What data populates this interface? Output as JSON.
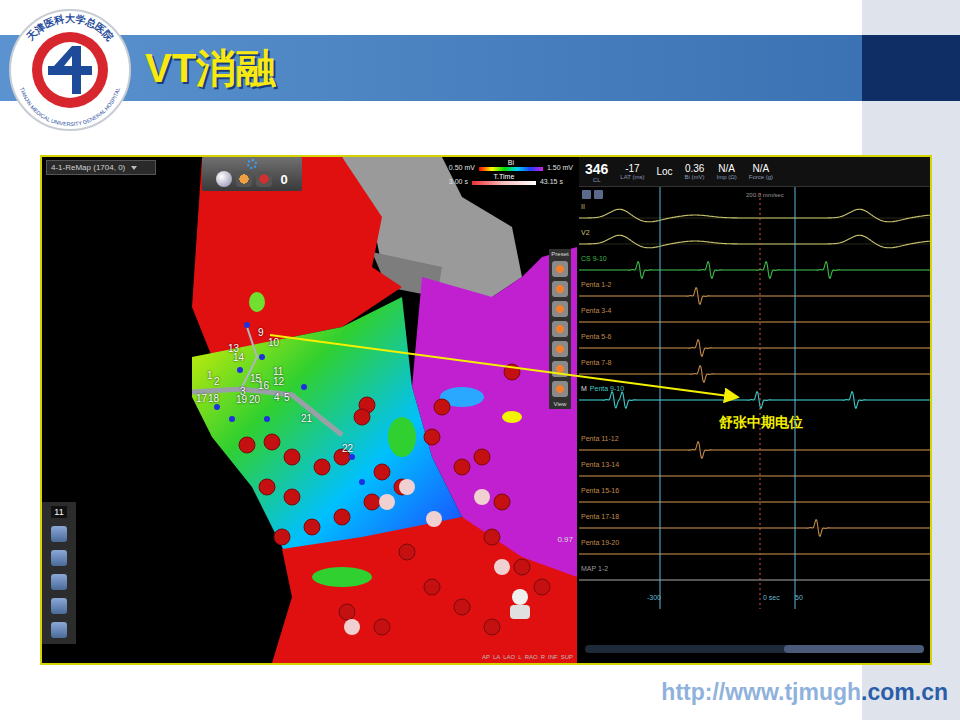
{
  "slide": {
    "title": "VT消融",
    "url_parts": [
      "http://www.tjmugh",
      ".com.cn"
    ]
  },
  "logo": {
    "ring_top": "天津医科大学总医院",
    "ring_bottom": "TIANJIN MEDICAL UNIVERSITY GENERAL HOSPITAL"
  },
  "map": {
    "dropdown": "4-1-ReMap (1704, 0)",
    "toolbar_count": "0",
    "legends": [
      {
        "min": "0.50 mV",
        "name": "Bi",
        "max": "1.50 mV",
        "kind": "rainbow"
      },
      {
        "min": "3.00 s",
        "name": "T.Time",
        "max": "43.15 s",
        "kind": "time"
      }
    ],
    "side_tools": [
      "Preset",
      "View"
    ],
    "left_tool_count": "11",
    "value": "0.97",
    "orientation": [
      "AP",
      "LA",
      "LAO",
      "L",
      "RAO",
      "R",
      "INF",
      "SUP"
    ],
    "electrodes": [
      "9",
      "10",
      "13",
      "14",
      "11",
      "12",
      "15",
      "16",
      "1",
      "2",
      "17",
      "18",
      "3",
      "19",
      "20",
      "4",
      "5",
      "21",
      "22"
    ]
  },
  "traces": {
    "readouts": [
      {
        "value": "346",
        "label": "CL"
      },
      {
        "value": "-17",
        "label": "LAT (ms)"
      },
      {
        "value": "Loc",
        "label": ""
      },
      {
        "value": "0.36",
        "label": "Bi (mV)"
      },
      {
        "value": "N/A",
        "label": "Imp (Ω)"
      },
      {
        "value": "N/A",
        "label": "Force (g)"
      }
    ],
    "speed": "200.0 mm/sec",
    "marker": "M",
    "axis": [
      "-300",
      "0 sec",
      "50"
    ],
    "annotation": {
      "text": "舒张中期电位",
      "channel": "Penta 9-10"
    },
    "channels": [
      {
        "name": "II",
        "color": "#c9c46f",
        "kind": "surface",
        "selected": false,
        "events_ms": [
          -420,
          300
        ]
      },
      {
        "name": "V2",
        "color": "#c9c46f",
        "kind": "surface",
        "selected": false,
        "events_ms": [
          -420,
          300
        ]
      },
      {
        "name": "CS 9-10",
        "color": "#3cb94a",
        "kind": "bipolar",
        "selected": false,
        "events_ms": [
          -360,
          -150,
          24,
          204
        ]
      },
      {
        "name": "Penta 1-2",
        "color": "#c08a4a",
        "kind": "bipolar",
        "selected": false,
        "events_ms": [
          -186
        ]
      },
      {
        "name": "Penta 3-4",
        "color": "#c08a4a",
        "kind": "bipolar",
        "selected": false,
        "events_ms": []
      },
      {
        "name": "Penta 5-6",
        "color": "#c08a4a",
        "kind": "bipolar",
        "selected": false,
        "events_ms": [
          -180
        ]
      },
      {
        "name": "Penta 7-8",
        "color": "#c08a4a",
        "kind": "bipolar",
        "selected": false,
        "events_ms": [
          -174
        ]
      },
      {
        "name": "Penta 9-10",
        "color": "#40c8c8",
        "kind": "bipolar",
        "selected": true,
        "events_ms": [
          -438,
          -408,
          -3,
          282
        ]
      },
      {
        "name": "Penta 11-12",
        "color": "#c08a4a",
        "kind": "bipolar",
        "selected": false,
        "events_ms": [
          -180
        ]
      },
      {
        "name": "Penta 13-14",
        "color": "#c08a4a",
        "kind": "bipolar",
        "selected": false,
        "events_ms": []
      },
      {
        "name": "Penta 15-16",
        "color": "#c08a4a",
        "kind": "bipolar",
        "selected": false,
        "events_ms": []
      },
      {
        "name": "Penta 17-18",
        "color": "#c08a4a",
        "kind": "bipolar",
        "selected": false,
        "events_ms": [
          174
        ]
      },
      {
        "name": "Penta 19-20",
        "color": "#c08a4a",
        "kind": "bipolar",
        "selected": false,
        "events_ms": []
      },
      {
        "name": "MAP 1-2",
        "color": "#9a9a9a",
        "kind": "bipolar",
        "selected": false,
        "events_ms": []
      }
    ]
  }
}
